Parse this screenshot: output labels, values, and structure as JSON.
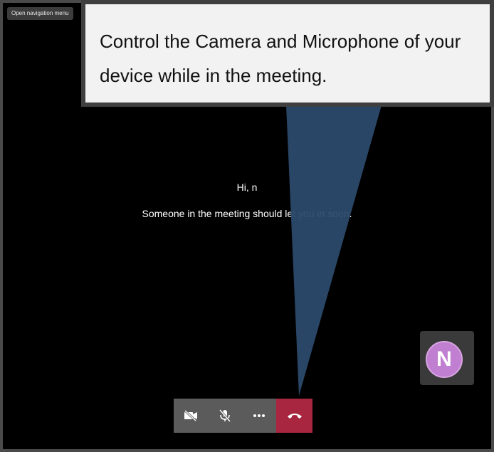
{
  "nav": {
    "open_menu_label": "Open navigation menu"
  },
  "callout": {
    "text": "Control the Camera and Microphone of your device while in the meeting."
  },
  "lobby": {
    "greeting": "Hi, n",
    "message": "Someone in the meeting should let you in soon."
  },
  "participant": {
    "initial": "N",
    "avatar_color": "#c07fd0"
  },
  "toolbar": {
    "buttons": [
      {
        "icon": "camera-off-icon"
      },
      {
        "icon": "mic-off-icon"
      },
      {
        "icon": "more-icon"
      },
      {
        "icon": "hang-up-icon",
        "color": "#a8263f"
      }
    ]
  },
  "colors": {
    "callout_pointer": "#2c4a6b",
    "background": "#000000"
  }
}
